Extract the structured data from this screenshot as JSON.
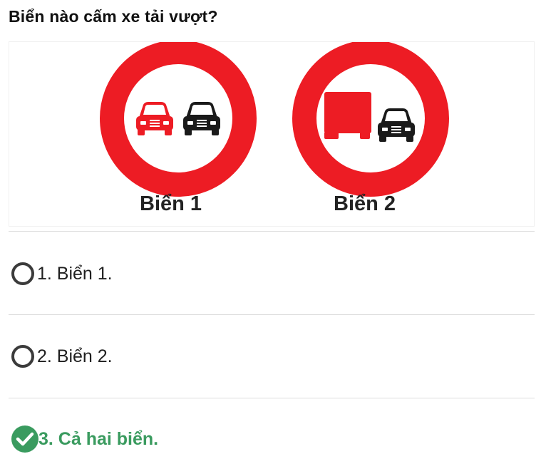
{
  "question": "Biển nào cấm xe tải vượt?",
  "image": {
    "sign1_label": "Biển 1",
    "sign2_label": "Biển 2",
    "colors": {
      "ring": "#ed1c24",
      "vehicle_dark": "#1a1a1a",
      "vehicle_red": "#ed1c24"
    }
  },
  "options": [
    {
      "label": "1. Biển 1.",
      "state": "unselected"
    },
    {
      "label": "2. Biển 2.",
      "state": "unselected"
    },
    {
      "label": "3. Cả hai biển.",
      "state": "correct"
    }
  ],
  "colors": {
    "correct": "#3a9b5f",
    "radio_border": "#3b3b3b",
    "divider": "#dcdcdc"
  }
}
